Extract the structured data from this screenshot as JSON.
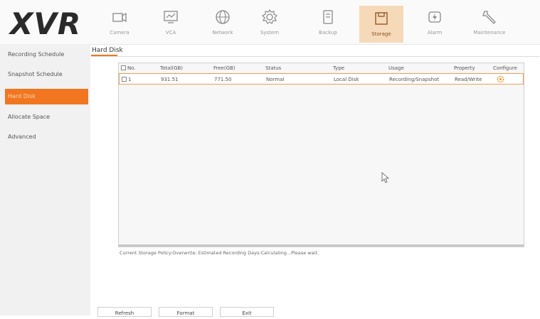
{
  "app": {
    "logo": "XVR"
  },
  "nav": [
    {
      "label": "Camera",
      "icon": "camera-icon"
    },
    {
      "label": "VCA",
      "icon": "vca-icon"
    },
    {
      "label": "Network",
      "icon": "globe-icon"
    },
    {
      "label": "System",
      "icon": "gear-icon"
    },
    {
      "label": "Backup",
      "icon": "backup-icon"
    },
    {
      "label": "Storage",
      "icon": "storage-icon",
      "active": true
    },
    {
      "label": "Alarm",
      "icon": "alarm-icon"
    },
    {
      "label": "Maintenance",
      "icon": "wrench-icon"
    }
  ],
  "sidebar": {
    "items": [
      {
        "label": "Recording Schedule"
      },
      {
        "label": "Snapshot Schedule"
      },
      {
        "label": "Hard Disk",
        "active": true
      },
      {
        "label": "Allocate Space"
      },
      {
        "label": "Advanced"
      }
    ]
  },
  "tab": {
    "label": "Hard Disk"
  },
  "table": {
    "columns": [
      "No.",
      "Total(GB)",
      "Free(GB)",
      "Status",
      "Type",
      "Usage",
      "Property",
      "Configure"
    ],
    "rows": [
      {
        "no": "1",
        "total": "931.51",
        "free": "771.50",
        "status": "Normal",
        "type": "Local Disk",
        "usage": "Recording/Snapshot",
        "property": "Read/Write",
        "configure_icon": "gear-icon"
      }
    ]
  },
  "policy": {
    "text": "Current Storage Policy:Overwrite; Estimated Recording Days:Calculating...Please wait."
  },
  "buttons": {
    "refresh": "Refresh",
    "format": "Format",
    "exit": "Exit"
  },
  "colors": {
    "accent": "#f2761f",
    "active_nav_bg": "#f6d9b9"
  }
}
